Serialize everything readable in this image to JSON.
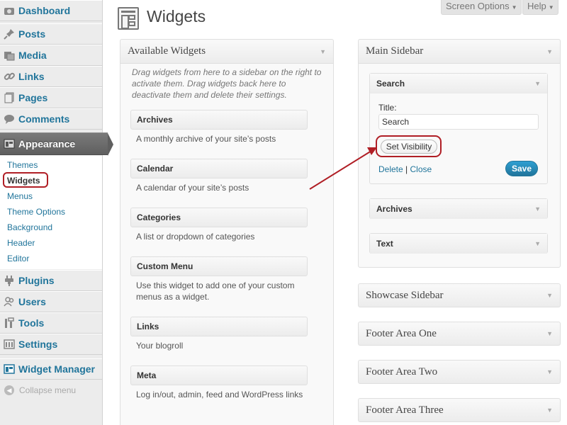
{
  "menu": {
    "items": [
      {
        "label": "Dashboard",
        "icon": "dashboard-icon"
      },
      {
        "label": "Posts",
        "icon": "pin-icon"
      },
      {
        "label": "Media",
        "icon": "media-icon"
      },
      {
        "label": "Links",
        "icon": "link-icon"
      },
      {
        "label": "Pages",
        "icon": "pages-icon"
      },
      {
        "label": "Comments",
        "icon": "comment-icon"
      },
      {
        "label": "Appearance",
        "icon": "appearance-icon"
      },
      {
        "label": "Plugins",
        "icon": "plugin-icon"
      },
      {
        "label": "Users",
        "icon": "users-icon"
      },
      {
        "label": "Tools",
        "icon": "tools-icon"
      },
      {
        "label": "Settings",
        "icon": "settings-icon"
      },
      {
        "label": "Widget Manager",
        "icon": "widget-manager-icon"
      }
    ],
    "submenu": [
      "Themes",
      "Widgets",
      "Menus",
      "Theme Options",
      "Background",
      "Header",
      "Editor"
    ],
    "collapse_label": "Collapse menu"
  },
  "header": {
    "title": "Widgets",
    "screen_options": "Screen Options",
    "help": "Help"
  },
  "available": {
    "title": "Available Widgets",
    "description": "Drag widgets from here to a sidebar on the right to activate them. Drag widgets back here to deactivate them and delete their settings.",
    "widgets": [
      {
        "name": "Archives",
        "desc": "A monthly archive of your site’s posts"
      },
      {
        "name": "Calendar",
        "desc": "A calendar of your site’s posts"
      },
      {
        "name": "Categories",
        "desc": "A list or dropdown of categories"
      },
      {
        "name": "Custom Menu",
        "desc": "Use this widget to add one of your custom menus as a widget."
      },
      {
        "name": "Links",
        "desc": "Your blogroll"
      },
      {
        "name": "Meta",
        "desc": "Log in/out, admin, feed and WordPress links"
      }
    ]
  },
  "main_sidebar": {
    "title": "Main Sidebar",
    "search_widget": {
      "title": "Search",
      "field_label": "Title:",
      "field_value": "Search",
      "visibility_button": "Set Visibility",
      "delete_link": "Delete",
      "separator": "|",
      "close_link": "Close",
      "save_button": "Save"
    },
    "other_widgets": [
      "Archives",
      "Text"
    ]
  },
  "other_sidebars": [
    "Showcase Sidebar",
    "Footer Area One",
    "Footer Area Two",
    "Footer Area Three"
  ],
  "colors": {
    "link": "#21759b",
    "highlight_ring": "#b01e25",
    "save_button": "#21759b"
  }
}
